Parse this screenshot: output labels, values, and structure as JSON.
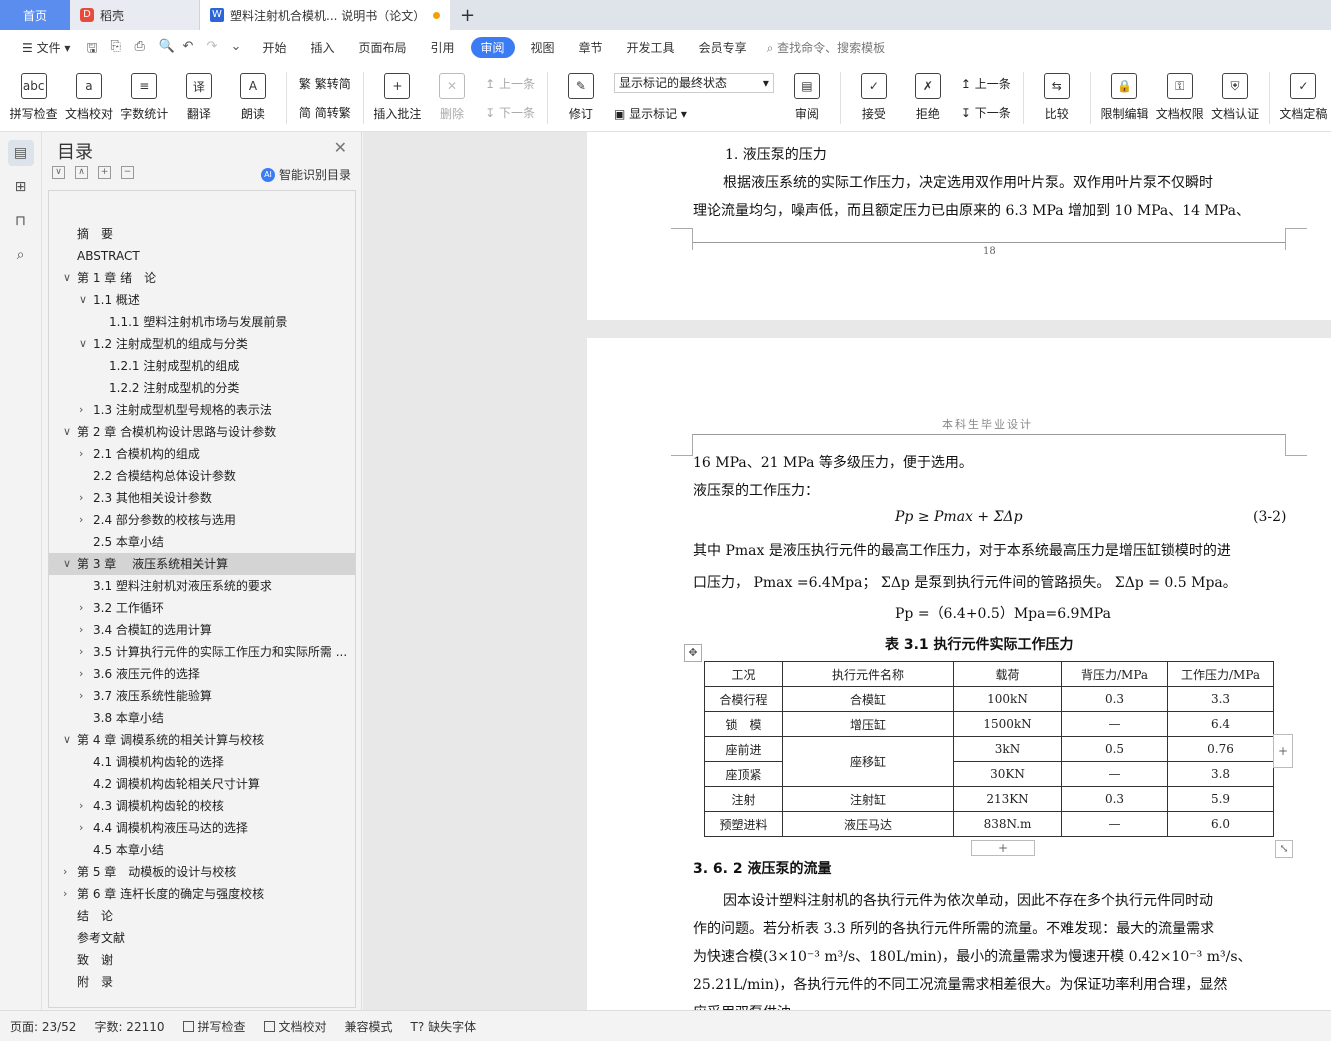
{
  "tabs": {
    "home": "首页",
    "daoke": "稻壳",
    "doc": "塑料注射机合模机... 说明书（论文）",
    "new_tab": "+"
  },
  "menu": {
    "file": "文件",
    "items": [
      "开始",
      "插入",
      "页面布局",
      "引用",
      "审阅",
      "视图",
      "章节",
      "开发工具",
      "会员专享"
    ],
    "active": "审阅",
    "search": "查找命令、搜索模板"
  },
  "ribbon": {
    "spellcheck": "拼写检查",
    "doc_proof": "文档校对",
    "word_count": "字数统计",
    "translate": "翻译",
    "read_aloud": "朗读",
    "trad": "繁转简",
    "simp": "简转繁",
    "insert_comment": "插入批注",
    "delete": "删除",
    "prev": "上一条",
    "next": "下一条",
    "revise": "修订",
    "display_state": "显示标记的最终状态",
    "show_markup": "显示标记",
    "review": "审阅",
    "accept": "接受",
    "reject": "拒绝",
    "prev2": "上一条",
    "next2": "下一条",
    "compare": "比较",
    "restrict_edit": "限制编辑",
    "doc_permission": "文档权限",
    "doc_cert": "文档认证",
    "doc_final": "文档定稿"
  },
  "toc": {
    "title": "目录",
    "smart": "智能识别目录",
    "items": [
      {
        "label": "摘　要",
        "level": 0,
        "chev": ""
      },
      {
        "label": "ABSTRACT",
        "level": 0,
        "chev": ""
      },
      {
        "label": "第 1 章 绪　论",
        "level": 0,
        "chev": "down"
      },
      {
        "label": "1.1 概述",
        "level": 1,
        "chev": "down"
      },
      {
        "label": "1.1.1 塑料注射机市场与发展前景",
        "level": 2,
        "chev": ""
      },
      {
        "label": "1.2 注射成型机的组成与分类",
        "level": 1,
        "chev": "down"
      },
      {
        "label": "1.2.1 注射成型机的组成",
        "level": 2,
        "chev": ""
      },
      {
        "label": "1.2.2  注射成型机的分类",
        "level": 2,
        "chev": ""
      },
      {
        "label": "1.3 注射成型机型号规格的表示法",
        "level": 1,
        "chev": "right"
      },
      {
        "label": "第 2 章  合模机构设计思路与设计参数",
        "level": 0,
        "chev": "down"
      },
      {
        "label": "2.1 合模机构的组成",
        "level": 1,
        "chev": "right"
      },
      {
        "label": "2.2 合模结构总体设计参数",
        "level": 1,
        "chev": ""
      },
      {
        "label": "2.3 其他相关设计参数",
        "level": 1,
        "chev": "right"
      },
      {
        "label": "2.4 部分参数的校核与选用",
        "level": 1,
        "chev": "right"
      },
      {
        "label": "2.5 本章小结",
        "level": 1,
        "chev": ""
      },
      {
        "label": "第 3 章　 液压系统相关计算",
        "level": 0,
        "chev": "down",
        "sel": true
      },
      {
        "label": "3.1 塑料注射机对液压系统的要求",
        "level": 1,
        "chev": ""
      },
      {
        "label": "3.2 工作循环",
        "level": 1,
        "chev": "right"
      },
      {
        "label": "3.4 合模缸的选用计算",
        "level": 1,
        "chev": "right"
      },
      {
        "label": "3.5 计算执行元件的实际工作压力和实际所需 ...",
        "level": 1,
        "chev": "right"
      },
      {
        "label": "3.6 液压元件的选择",
        "level": 1,
        "chev": "right"
      },
      {
        "label": "3.7 液压系统性能验算",
        "level": 1,
        "chev": "right"
      },
      {
        "label": "3.8 本章小结",
        "level": 1,
        "chev": ""
      },
      {
        "label": "第 4 章  调模系统的相关计算与校核",
        "level": 0,
        "chev": "down"
      },
      {
        "label": "4.1 调模机构齿轮的选择",
        "level": 1,
        "chev": ""
      },
      {
        "label": "4.2 调模机构齿轮相关尺寸计算",
        "level": 1,
        "chev": ""
      },
      {
        "label": "4.3 调模机构齿轮的校核",
        "level": 1,
        "chev": "right"
      },
      {
        "label": "4.4 调模机构液压马达的选择",
        "level": 1,
        "chev": "right"
      },
      {
        "label": "4.5 本章小结",
        "level": 1,
        "chev": ""
      },
      {
        "label": "第 5 章　动模板的设计与校核",
        "level": 0,
        "chev": "right"
      },
      {
        "label": "第 6 章  连杆长度的确定与强度校核",
        "level": 0,
        "chev": "right"
      },
      {
        "label": "结　论",
        "level": 0,
        "chev": ""
      },
      {
        "label": "参考文献",
        "level": 0,
        "chev": ""
      },
      {
        "label": "致　谢",
        "level": 0,
        "chev": ""
      },
      {
        "label": "附　录",
        "level": 0,
        "chev": ""
      }
    ]
  },
  "page1": {
    "heading": "1.   液压泵的压力",
    "p1": "根据液压系统的实际工作压力，决定选用双作用叶片泵。双作用叶片泵不仅瞬时",
    "p2": "理论流量均匀，噪声低，而且额定压力已由原来的 6.3 MPa 增加到 10 MPa、14 MPa、",
    "page_number": "18"
  },
  "page2": {
    "header": "本科生毕业设计",
    "l1": "16 MPa、21 MPa 等多级压力，便于选用。",
    "l2": "液压泵的工作压力：",
    "formula": "Pp ≥ Pmax + ΣΔp",
    "formula_no": "(3-2)",
    "l3": "其中 Pmax 是液压执行元件的最高工作压力，对于本系统最高压力是增压缸锁模时的进",
    "l4": "口压力，  Pmax =6.4Mpa；  ΣΔp 是泵到执行元件间的管路损失。 ΣΔp = 0.5 Mpa。",
    "l5": "Pp =（6.4+0.5）Mpa=6.9MPa",
    "table_title": "表 3.1  执行元件实际工作压力",
    "table_headers": [
      "工况",
      "执行元件名称",
      "载荷",
      "背压力/MPa",
      "工作压力/MPa"
    ],
    "table_rows": [
      [
        "合模行程",
        "合模缸",
        "100kN",
        "0.3",
        "3.3"
      ],
      [
        "锁　模",
        "增压缸",
        "1500kN",
        "—",
        "6.4"
      ],
      [
        "座前进",
        "座移缸",
        "3kN",
        "0.5",
        "0.76"
      ],
      [
        "座顶紧",
        "",
        "30KN",
        "—",
        "3.8"
      ],
      [
        "注射",
        "注射缸",
        "213KN",
        "0.3",
        "5.9"
      ],
      [
        "预塑进料",
        "液压马达",
        "838N.m",
        "—",
        "6.0"
      ]
    ],
    "section": "3. 6. 2  液压泵的流量",
    "b1": "因本设计塑料注射机的各执行元件为依次单动，因此不存在多个执行元件同时动",
    "b2": "作的问题。若分析表 3.3 所列的各执行元件所需的流量。不难发现：最大的流量需求",
    "b3": "为快速合模(3×10⁻³ m³/s、180L/min)，最小的流量需求为慢速开模 0.42×10⁻³ m³/s、",
    "b4": "25.21L/min)，各执行元件的不同工况流量需求相差很大。为保证功率利用合理，显然",
    "b5": "应采用双泵供油"
  },
  "status": {
    "page": "页面: 23/52",
    "words": "字数: 22110",
    "spell": "拼写检查",
    "proof": "文档校对",
    "compat": "兼容模式",
    "font": "缺失字体"
  }
}
